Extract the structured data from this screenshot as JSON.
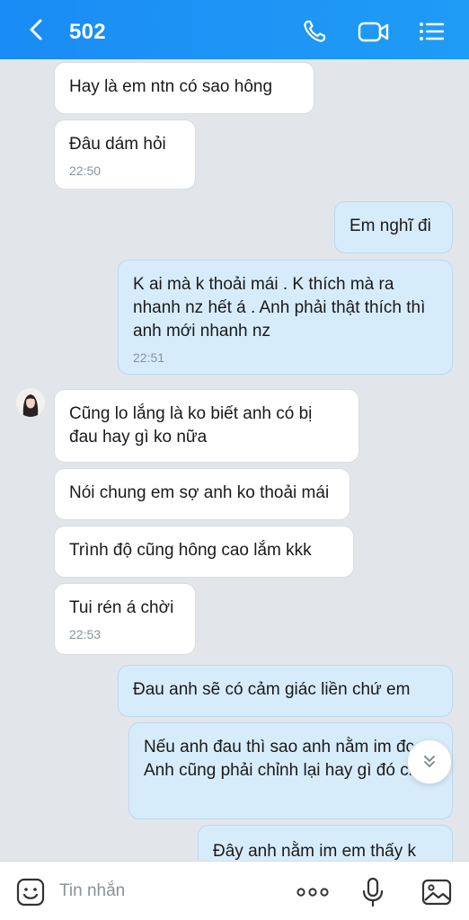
{
  "header": {
    "title": "502",
    "back_icon": "chevron-left-icon",
    "call_icon": "phone-icon",
    "video_icon": "video-call-icon",
    "menu_icon": "list-menu-icon",
    "background": "#1a8cf5"
  },
  "messages": [
    {
      "side": "in",
      "text": "Hay là em ntn có sao hông",
      "time": ""
    },
    {
      "side": "in",
      "text": "Đâu dám hỏi",
      "time": "22:50"
    },
    {
      "side": "out",
      "text": "Em nghĩ đi",
      "time": ""
    },
    {
      "side": "out",
      "text": "K ai mà k thoải mái . K thích mà ra nhanh nz hết á . Anh phải thật thích thì anh mới nhanh nz",
      "time": "22:51"
    },
    {
      "side": "in",
      "text": "Cũng lo lắng là ko biết anh có bị đau hay gì ko nữa",
      "time": ""
    },
    {
      "side": "in",
      "text": "Nói chung em sợ anh ko thoải mái",
      "time": ""
    },
    {
      "side": "in",
      "text": "Trình độ cũng hông cao lắm kkk",
      "time": ""
    },
    {
      "side": "in",
      "text": "Tui rén á chời",
      "time": "22:53"
    },
    {
      "side": "out",
      "text": "Đau anh sẽ có cảm giác liền chứ em",
      "time": ""
    },
    {
      "side": "out",
      "text": "Nếu anh đau thì sao anh nằm im đc . Anh cũng phải chỉnh lại hay gì đó chứ",
      "time": ""
    },
    {
      "side": "out",
      "text": "Đây anh nằm im em thấy k",
      "time": ""
    }
  ],
  "composer": {
    "placeholder": "Tin nhắn",
    "sticker_icon": "sticker-icon",
    "more_icon": "more-dots-icon",
    "mic_icon": "microphone-icon",
    "image_icon": "image-icon"
  },
  "colors": {
    "incoming_bubble": "#ffffff",
    "outgoing_bubble": "#d7ecfb",
    "chat_background": "#e2e6ea"
  }
}
